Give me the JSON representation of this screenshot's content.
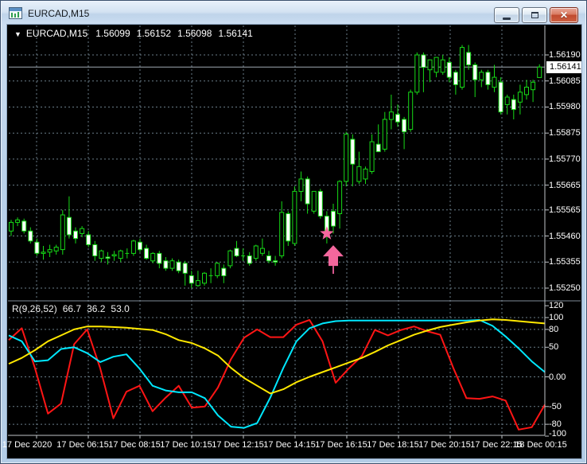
{
  "window": {
    "title": "EURCAD,M15"
  },
  "titlebar": {
    "buttons": [
      "minimize",
      "restore",
      "close"
    ],
    "close_glyph": "x"
  },
  "chart_header": {
    "collapse_icon": "▼",
    "symbol": "EURCAD,M15",
    "open": "1.56099",
    "high": "1.56152",
    "low": "1.56098",
    "close": "1.56141"
  },
  "price_scale": {
    "ticks": [
      "1.56190",
      "1.56085",
      "1.55980",
      "1.55875",
      "1.55770",
      "1.55665",
      "1.55565",
      "1.55460",
      "1.55355",
      "1.55250"
    ],
    "current": "1.56141"
  },
  "time_scale": {
    "labels": [
      "17 Dec 2020",
      "17 Dec 06:15",
      "17 Dec 08:15",
      "17 Dec 10:15",
      "17 Dec 12:15",
      "17 Dec 14:15",
      "17 Dec 16:15",
      "17 Dec 18:15",
      "17 Dec 20:15",
      "17 Dec 22:15",
      "18 Dec 00:15"
    ]
  },
  "indicator_panel": {
    "title": "R(9,26,52)",
    "values": [
      "66.7",
      "36.2",
      "53.0"
    ]
  },
  "indicator_scale": {
    "ticks": [
      {
        "value": 120,
        "label": "120"
      },
      {
        "value": 100,
        "label": "100"
      },
      {
        "value": 80,
        "label": "80"
      },
      {
        "value": 50,
        "label": "50"
      },
      {
        "value": 0,
        "label": "0.00"
      },
      {
        "value": -50,
        "label": "-50"
      },
      {
        "value": -80,
        "label": "-80"
      },
      {
        "value": -100,
        "label": "-100"
      }
    ]
  },
  "colors": {
    "background": "#000000",
    "grid": "#6a7d89",
    "candle": "#17da17",
    "bear_fill": "#ffffff",
    "marker_pink": "#f4679d",
    "marker_pink_dark": "#d5568c",
    "osc_red": "#ff1515",
    "osc_cyan": "#00e8ff",
    "osc_yellow": "#ffe800",
    "axis_line": "#c0c4c8",
    "current_price_line": "#9fa9b2",
    "separator": "#7f8c99"
  },
  "chart_data": {
    "type": "candlestick",
    "symbol": "EURCAD",
    "period": "M15",
    "price_range": [
      1.5525,
      1.5619
    ],
    "price_gridlines": [
      1.5619,
      1.56085,
      1.5598,
      1.55875,
      1.5577,
      1.55665,
      1.55565,
      1.5546,
      1.55355,
      1.5525
    ],
    "current_price": 1.56141,
    "candles": [
      [
        1.5548,
        1.55525,
        1.5546,
        1.55515
      ],
      [
        1.55515,
        1.55535,
        1.555,
        1.55525
      ],
      [
        1.5552,
        1.5553,
        1.5547,
        1.5548
      ],
      [
        1.5548,
        1.55495,
        1.5543,
        1.5544
      ],
      [
        1.55435,
        1.5545,
        1.5538,
        1.5539
      ],
      [
        1.5539,
        1.5542,
        1.55365,
        1.55395
      ],
      [
        1.55395,
        1.55425,
        1.55375,
        1.55405
      ],
      [
        1.554,
        1.55425,
        1.55385,
        1.55415
      ],
      [
        1.55405,
        1.55565,
        1.55385,
        1.55545
      ],
      [
        1.55535,
        1.5562,
        1.5545,
        1.55465
      ],
      [
        1.5548,
        1.55495,
        1.5543,
        1.5545
      ],
      [
        1.5547,
        1.555,
        1.55455,
        1.5549
      ],
      [
        1.55465,
        1.5548,
        1.55415,
        1.55425
      ],
      [
        1.55425,
        1.5544,
        1.5536,
        1.5538
      ],
      [
        1.5537,
        1.55405,
        1.55355,
        1.554
      ],
      [
        1.55375,
        1.55395,
        1.55345,
        1.5537
      ],
      [
        1.5538,
        1.554,
        1.5536,
        1.55385
      ],
      [
        1.5537,
        1.55405,
        1.55355,
        1.554
      ],
      [
        1.5539,
        1.5541,
        1.5537,
        1.5539
      ],
      [
        1.5539,
        1.55445,
        1.5538,
        1.5544
      ],
      [
        1.55435,
        1.5545,
        1.55395,
        1.55405
      ],
      [
        1.5541,
        1.55425,
        1.55365,
        1.5537
      ],
      [
        1.5536,
        1.55395,
        1.5535,
        1.5539
      ],
      [
        1.5539,
        1.554,
        1.5533,
        1.5535
      ],
      [
        1.5536,
        1.55375,
        1.5532,
        1.5533
      ],
      [
        1.5533,
        1.5537,
        1.5532,
        1.5536
      ],
      [
        1.55355,
        1.55365,
        1.5531,
        1.5532
      ],
      [
        1.5535,
        1.5536,
        1.5526,
        1.5531
      ],
      [
        1.553,
        1.5532,
        1.5525,
        1.5527
      ],
      [
        1.5526,
        1.5532,
        1.55255,
        1.5528
      ],
      [
        1.5527,
        1.55315,
        1.5526,
        1.5531
      ],
      [
        1.553,
        1.5533,
        1.5527,
        1.553
      ],
      [
        1.553,
        1.55355,
        1.5529,
        1.5535
      ],
      [
        1.5533,
        1.55345,
        1.5527,
        1.553
      ],
      [
        1.5534,
        1.55405,
        1.5533,
        1.554
      ],
      [
        1.5541,
        1.5544,
        1.55375,
        1.5538
      ],
      [
        1.5538,
        1.5541,
        1.5536,
        1.5538
      ],
      [
        1.5538,
        1.55395,
        1.5534,
        1.5535
      ],
      [
        1.5537,
        1.55425,
        1.5536,
        1.5542
      ],
      [
        1.5539,
        1.5545,
        1.5538,
        1.5541
      ],
      [
        1.5538,
        1.554,
        1.5535,
        1.5536
      ],
      [
        1.5536,
        1.5538,
        1.5534,
        1.55355
      ],
      [
        1.5538,
        1.556,
        1.5537,
        1.55555
      ],
      [
        1.5555,
        1.5556,
        1.5542,
        1.5544
      ],
      [
        1.5543,
        1.5566,
        1.5542,
        1.5564
      ],
      [
        1.5564,
        1.5572,
        1.556,
        1.5569
      ],
      [
        1.5569,
        1.557,
        1.5555,
        1.5559
      ],
      [
        1.5556,
        1.5564,
        1.5555,
        1.5564
      ],
      [
        1.5564,
        1.5565,
        1.5553,
        1.5554
      ],
      [
        1.5554,
        1.5556,
        1.5543,
        1.5548
      ],
      [
        1.5556,
        1.5559,
        1.5547,
        1.555
      ],
      [
        1.5555,
        1.55685,
        1.5549,
        1.5568
      ],
      [
        1.5568,
        1.5588,
        1.5566,
        1.5587
      ],
      [
        1.5585,
        1.5587,
        1.5566,
        1.5575
      ],
      [
        1.5568,
        1.558,
        1.5567,
        1.5574
      ],
      [
        1.5569,
        1.5574,
        1.5567,
        1.5573
      ],
      [
        1.5572,
        1.5587,
        1.5571,
        1.5584
      ],
      [
        1.5583,
        1.5591,
        1.558,
        1.558
      ],
      [
        1.5581,
        1.5596,
        1.558,
        1.5593
      ],
      [
        1.5593,
        1.5603,
        1.5589,
        1.5596
      ],
      [
        1.5595,
        1.5599,
        1.559,
        1.5592
      ],
      [
        1.5593,
        1.5594,
        1.5581,
        1.5588
      ],
      [
        1.5589,
        1.5605,
        1.5588,
        1.5604
      ],
      [
        1.5604,
        1.562,
        1.5603,
        1.5619
      ],
      [
        1.5619,
        1.562,
        1.5604,
        1.5614
      ],
      [
        1.5613,
        1.5617,
        1.5608,
        1.5617
      ],
      [
        1.5612,
        1.5618,
        1.561,
        1.5618
      ],
      [
        1.5612,
        1.5619,
        1.5611,
        1.5617
      ],
      [
        1.5616,
        1.5618,
        1.5608,
        1.561
      ],
      [
        1.5612,
        1.5613,
        1.5603,
        1.5607
      ],
      [
        1.5606,
        1.5623,
        1.5605,
        1.5622
      ],
      [
        1.562,
        1.5623,
        1.5613,
        1.5615
      ],
      [
        1.5615,
        1.5616,
        1.5602,
        1.5609
      ],
      [
        1.5609,
        1.5613,
        1.5606,
        1.5612
      ],
      [
        1.5612,
        1.5613,
        1.5605,
        1.5607
      ],
      [
        1.5606,
        1.5615,
        1.5604,
        1.561
      ],
      [
        1.5608,
        1.561,
        1.5595,
        1.5596
      ],
      [
        1.5599,
        1.5603,
        1.5595,
        1.5602
      ],
      [
        1.5601,
        1.5603,
        1.5593,
        1.5597
      ],
      [
        1.56,
        1.5607,
        1.5595,
        1.5604
      ],
      [
        1.5603,
        1.5609,
        1.5601,
        1.5606
      ],
      [
        1.5605,
        1.5609,
        1.56,
        1.5608
      ],
      [
        1.56099,
        1.56152,
        1.56098,
        1.56141
      ]
    ],
    "markers": [
      {
        "type": "star",
        "bar": 49,
        "price": 1.5547
      },
      {
        "type": "up-arrow",
        "bar": 50,
        "price": 1.55423
      }
    ],
    "oscillator": {
      "label": "R(9,26,52)",
      "displayed_values": [
        66.7,
        36.2,
        53.0
      ],
      "range": [
        -100,
        120
      ],
      "gridlines": [
        100,
        80,
        50,
        0,
        -50,
        -80
      ],
      "series": [
        {
          "name": "red",
          "values": [
            62,
            82,
            15,
            -62,
            -45,
            55,
            80,
            14,
            -70,
            -25,
            -15,
            -58,
            -35,
            -15,
            -52,
            -50,
            -18,
            30,
            66,
            80,
            67,
            67,
            88,
            96,
            60,
            -10,
            14,
            35,
            79,
            70,
            79,
            85,
            77,
            71,
            15,
            -36,
            -37,
            -33,
            -40,
            -89,
            -85,
            -47
          ]
        },
        {
          "name": "cyan",
          "values": [
            70,
            60,
            26,
            28,
            47,
            50,
            40,
            25,
            34,
            38,
            14,
            -15,
            -23,
            -26,
            -26,
            -36,
            -65,
            -84,
            -86,
            -78,
            -35,
            15,
            60,
            82,
            90,
            94,
            95,
            95,
            95,
            95,
            95,
            95,
            95,
            95,
            95,
            95,
            96,
            86,
            68,
            48,
            26,
            8
          ]
        },
        {
          "name": "yellow",
          "values": [
            22,
            32,
            45,
            60,
            70,
            80,
            85,
            85,
            84,
            83,
            81,
            79,
            72,
            62,
            57,
            48,
            36,
            15,
            -2,
            -15,
            -28,
            -21,
            -9,
            0,
            8,
            16,
            24,
            32,
            42,
            53,
            62,
            71,
            78,
            84,
            88,
            92,
            95,
            97,
            96,
            94,
            92,
            90
          ]
        }
      ]
    }
  }
}
